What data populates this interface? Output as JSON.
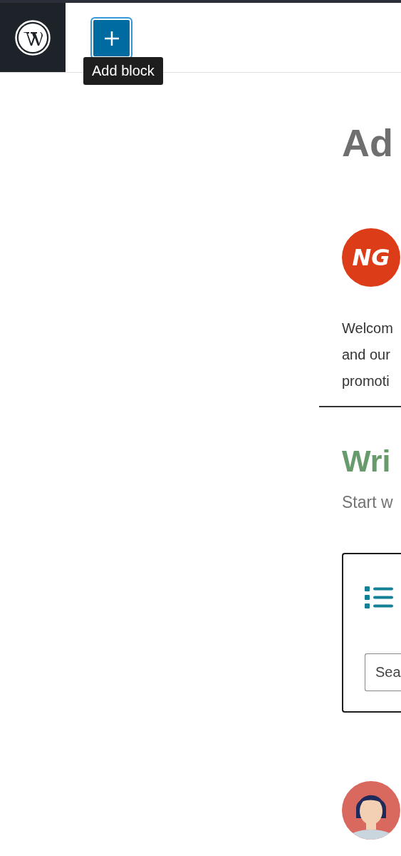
{
  "toolbar": {
    "add_button": {
      "tooltip": "Add block",
      "hovered": true
    }
  },
  "content": {
    "title": "Ad",
    "logo": {
      "text": "NG"
    },
    "paragraph": [
      "Welcom",
      "and our",
      "promoti"
    ],
    "section_heading": "Wri",
    "section_text": "Start w",
    "widget": {
      "search": {
        "placeholder": "Sea"
      }
    }
  }
}
